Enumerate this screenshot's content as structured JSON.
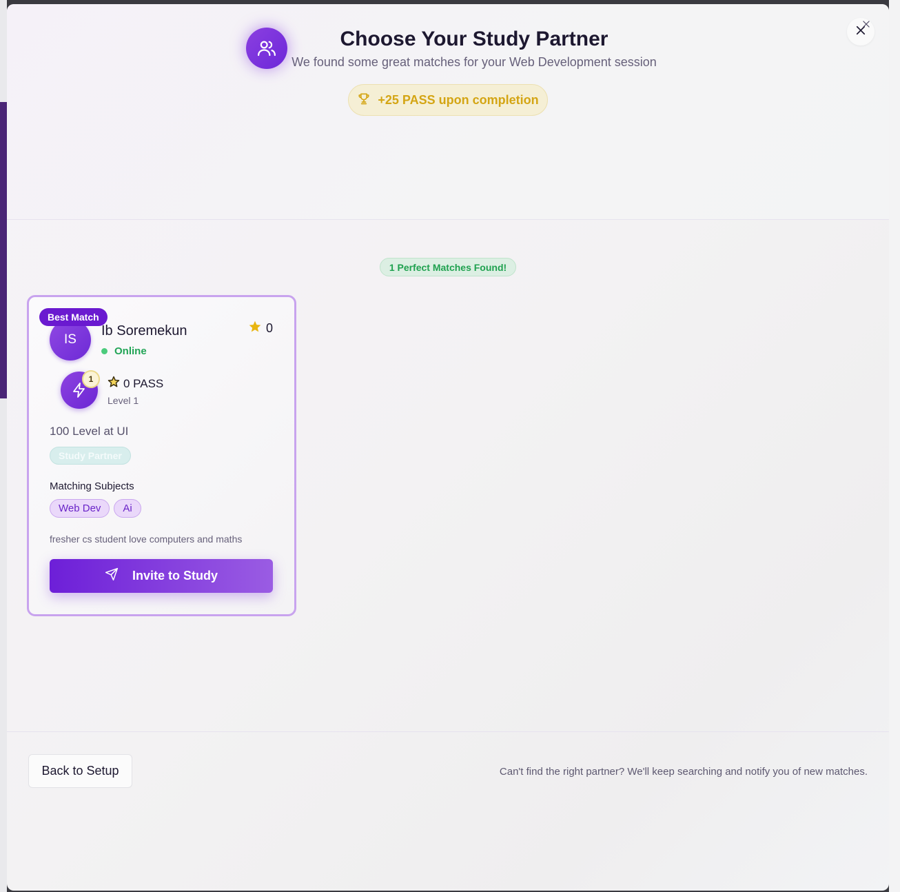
{
  "header": {
    "title": "Choose Your Study Partner",
    "subtitle": "We found some great matches for your Web Development session",
    "reward": "+25 PASS upon completion",
    "icon": "users-icon"
  },
  "matches": {
    "badge": "1 Perfect Matches Found!"
  },
  "card": {
    "best_badge": "Best Match",
    "initials": "IS",
    "name": "Ib Soremekun",
    "status": "Online",
    "rating": "0",
    "level_badge": "1",
    "pass": "0 PASS",
    "level": "Level 1",
    "university": "100 Level at UI",
    "role": "Study Partner",
    "subjects_label": "Matching Subjects",
    "subjects": [
      "Web Dev",
      "Ai"
    ],
    "bio": "fresher cs student love computers and maths",
    "invite_label": "Invite to Study"
  },
  "footer": {
    "back_label": "Back to Setup",
    "note": "Can't find the right partner? We'll keep searching and notify you of new matches."
  },
  "colors": {
    "accent": "#6d1fd8",
    "reward": "#d4a514",
    "online": "#22a456"
  }
}
